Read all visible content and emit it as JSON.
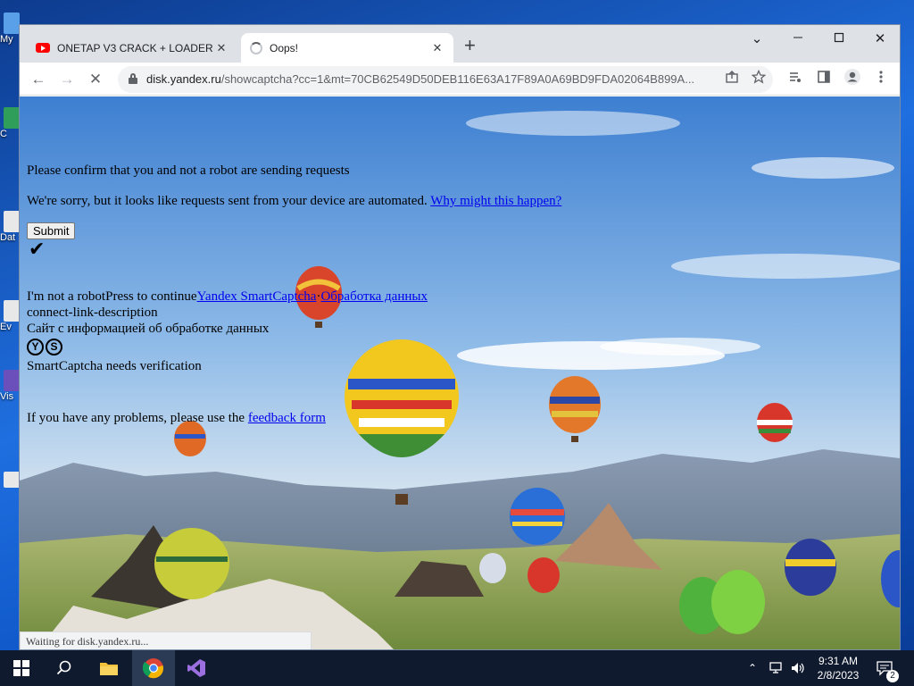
{
  "desktop": {
    "icons": [
      {
        "label": "My",
        "color": "#5aa0e8"
      },
      {
        "label": "C",
        "color": "#2e9e5a"
      },
      {
        "label": "Dat",
        "color": "#e8e8e8"
      },
      {
        "label": "Ev",
        "color": "#e8e8e8"
      },
      {
        "label": "Vis",
        "color": "#6b4fbb"
      },
      {
        "label": "",
        "color": "#e8e8e8"
      }
    ]
  },
  "browser": {
    "tabs": [
      {
        "title": "ONETAP V3 CRACK + LOADER Ο̉",
        "favicon": "youtube-icon",
        "close": "✕"
      },
      {
        "title": "Oops!",
        "favicon": "loading-spinner-icon",
        "close": "✕"
      }
    ],
    "new_tab": "+",
    "window_controls": {
      "minimize": "⌄",
      "restore": "—",
      "maximize": "☐",
      "close": "✕"
    },
    "nav": {
      "back": "←",
      "forward": "→",
      "stop": "✕"
    },
    "address": {
      "domain": "disk.yandex.ru",
      "path": "/showcaptcha?cc=1&mt=70CB62549D50DEB116E63A17F89A0A69BD9FDA02064B899A..."
    },
    "omnibox_icons": [
      "share-icon",
      "bookmark-star-icon"
    ],
    "toolbar_icons": [
      "media-control-icon",
      "side-panel-icon",
      "profile-icon",
      "menu-icon"
    ],
    "status_text": "Waiting for disk.yandex.ru..."
  },
  "page": {
    "heading": "Please confirm that you and not a robot are sending requests",
    "sorry_text": "We're sorry, but it looks like requests sent from your device are automated. ",
    "why_link": "Why might this happen?",
    "submit_label": "Submit",
    "checkmark": "✔",
    "robot_text": "I'm not a robotPress to continue",
    "smartcaptcha_link": "Yandex SmartCaptcha",
    "data_link": "Обработка данных",
    "link_description": "connect-link-description",
    "data_site_text": "Сайт с информацией об обработке данных",
    "logo_letters": [
      "Y",
      "S"
    ],
    "verify_text": "SmartCaptcha needs verification",
    "problems_text": "If you have any problems, please use the ",
    "feedback_link": "feedback form"
  },
  "taskbar": {
    "apps": [
      "windows-start-icon",
      "search-icon",
      "file-explorer-icon",
      "chrome-icon",
      "visual-studio-icon"
    ],
    "tray": {
      "chevron": "⌃",
      "time": "9:31 AM",
      "date": "2/8/2023",
      "notification_count": "2"
    }
  }
}
